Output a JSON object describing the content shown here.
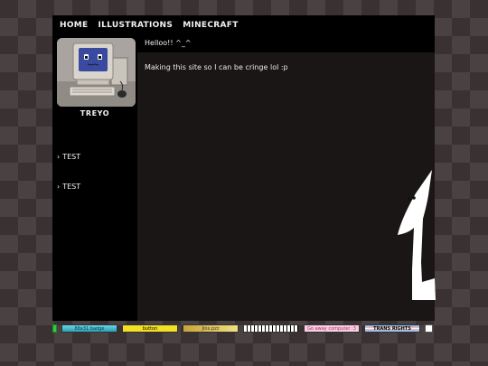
{
  "nav": {
    "items": [
      {
        "label": "HOME"
      },
      {
        "label": "ILLUSTRATIONS"
      },
      {
        "label": "MINECRAFT"
      }
    ]
  },
  "profile": {
    "name": "TREYO",
    "avatar_icon": "retro-computer-icon"
  },
  "sidebar": {
    "links": [
      {
        "chevron": "›",
        "label": "TEST"
      },
      {
        "chevron": "›",
        "label": "TEST"
      }
    ]
  },
  "main": {
    "greeting": "Helloo!! ^_^",
    "intro": "Making this site so I can be cringe lol :p"
  },
  "footer": {
    "badges": [
      {
        "label": ""
      },
      {
        "label": "88x31 badge"
      },
      {
        "label": "button"
      },
      {
        "label": "Jinx.pzz"
      },
      {
        "label": ""
      },
      {
        "label": "Go away computer :3"
      },
      {
        "label": "TRANS RIGHTS"
      },
      {
        "label": ""
      }
    ]
  },
  "colors": {
    "background": "#3a3232",
    "panel": "#1a1616",
    "bar": "#000000",
    "text": "#f2f2f2"
  }
}
